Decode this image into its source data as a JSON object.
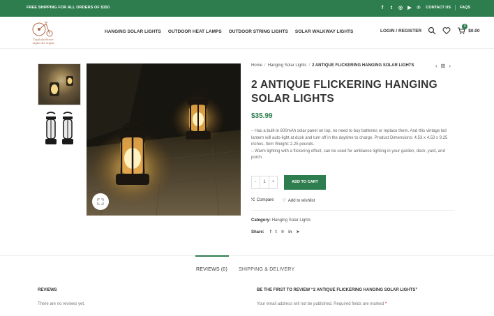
{
  "topbar": {
    "shipping": "FREE SHIPPING FOR ALL ORDERS OF $150",
    "social_icons": [
      "facebook-icon",
      "twitter-icon",
      "instagram-icon",
      "youtube-icon",
      "pinterest-icon"
    ],
    "social_glyphs": [
      "f",
      "t",
      "◎",
      "▶",
      "℗"
    ],
    "links": [
      "CONTACT US",
      "FAQS"
    ]
  },
  "logo": {
    "name": "TopSolarStore",
    "tagline": "Light the Night"
  },
  "nav": [
    "HANGING SOLAR LIGHTS",
    "OUTDOOR HEAT LAMPS",
    "OUTDOOR STRING LIGHTS",
    "SOLAR WALKWAY LIGHTS"
  ],
  "header": {
    "login": "LOGIN / REGISTER",
    "cart_count": "0",
    "cart_total": "$0.00"
  },
  "breadcrumb": {
    "home": "Home",
    "category": "Hanging Solar Lights",
    "current": "2 ANTIQUE FLICKERING HANGING SOLAR LIGHTS"
  },
  "product": {
    "title": "2 ANTIQUE FLICKERING HANGING SOLAR LIGHTS",
    "price": "$35.99",
    "description": [
      "– Has a built-in 600mAh solar panel on top, no need to buy batteries or replace them. And this vintage led lantern will auto-light at dusk and turn off in the daytime to charge. Product Dimensions: 4.53 x 4.53 x 9.25 inches, Item Weight: 2.25 pounds.",
      "– Warm lighting with a flickering effect, can be used for ambiance lighting in your garden, deck, yard, and porch."
    ],
    "qty_minus": "-",
    "qty_value": "1",
    "qty_plus": "+",
    "add_to_cart": "ADD TO CART",
    "compare": "Compare",
    "wishlist": "Add to wishlist",
    "category_label": "Category:",
    "category_value": "Hanging Solar Lights",
    "share_label": "Share:",
    "share_icons": [
      "facebook-icon",
      "twitter-icon",
      "pinterest-icon",
      "linkedin-icon",
      "telegram-icon"
    ],
    "share_glyphs": [
      "f",
      "t",
      "℗",
      "in",
      "➤"
    ]
  },
  "tabs": [
    "REVIEWS (0)",
    "SHIPPING & DELIVERY"
  ],
  "reviews": {
    "heading": "REVIEWS",
    "empty": "There are no reviews yet.",
    "form_heading": "BE THE FIRST TO REVIEW “2 ANTIQUE FLICKERING HANGING SOLAR LIGHTS”",
    "email_note": "Your email address will not be published. Required fields are marked",
    "required_mark": "*"
  },
  "colors": {
    "brand_green": "#2e7d4f"
  }
}
